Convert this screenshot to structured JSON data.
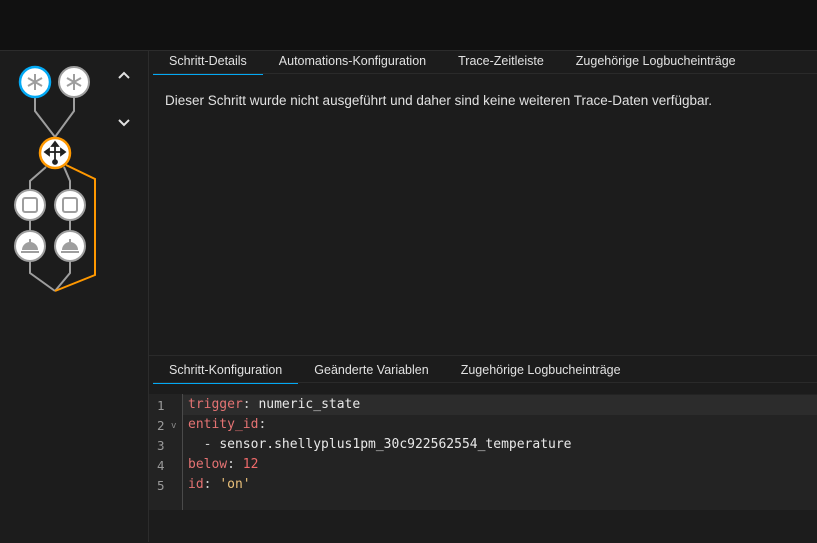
{
  "upper_tabs": [
    {
      "label": "Schritt-Details",
      "active": true
    },
    {
      "label": "Automations-Konfiguration"
    },
    {
      "label": "Trace-Zeitleiste"
    },
    {
      "label": "Zugehörige Logbucheinträge"
    }
  ],
  "message": "Dieser Schritt wurde nicht ausgeführt und daher sind keine weiteren Trace-Daten verfügbar.",
  "lower_tabs": [
    {
      "label": "Schritt-Konfiguration",
      "active": true
    },
    {
      "label": "Geänderte Variablen"
    },
    {
      "label": "Zugehörige Logbucheinträge"
    }
  ],
  "code": {
    "line_numbers": [
      "1",
      "2",
      "3",
      "4",
      "5"
    ],
    "fold_marker": "v",
    "line1_key": "trigger",
    "line1_value": "numeric_state",
    "line2_key": "entity_id",
    "line3_value": "sensor.shellyplus1pm_30c922562554_temperature",
    "line4_key": "below",
    "line4_value": "12",
    "line5_key": "id",
    "line5_value": "'on'"
  },
  "graph": {
    "nodes": [
      {
        "icon": "trigger-asterisk-icon",
        "state": "active"
      },
      {
        "icon": "trigger-asterisk-icon",
        "state": "inactive"
      },
      {
        "icon": "choose-branch-icon",
        "state": "selected"
      },
      {
        "icon": "condition-square-icon",
        "state": "inactive"
      },
      {
        "icon": "condition-square-icon",
        "state": "inactive"
      },
      {
        "icon": "service-bell-icon",
        "state": "inactive"
      },
      {
        "icon": "service-bell-icon",
        "state": "inactive"
      }
    ],
    "nav": [
      "chevron-up-icon",
      "chevron-down-icon"
    ]
  },
  "colors": {
    "accent_blue": "#03a9f4",
    "trace_orange": "#ff9800",
    "yaml_key": "#e57373",
    "yaml_string": "#eac07a"
  }
}
